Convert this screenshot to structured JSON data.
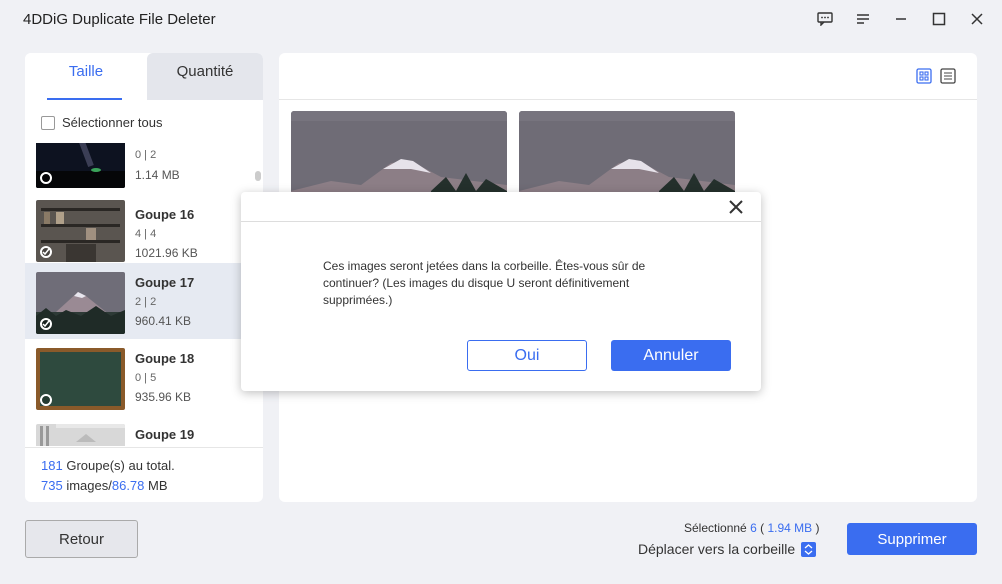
{
  "app": {
    "title": "4DDiG Duplicate File Deleter"
  },
  "tabs": [
    {
      "label": "Taille",
      "active": true
    },
    {
      "label": "Quantité",
      "active": false
    }
  ],
  "select_all_label": "Sélectionner tous",
  "groups": [
    {
      "name": "",
      "count": "0 | 2",
      "size": "1.14 MB",
      "checked": false,
      "thumb": "night-sky-icon"
    },
    {
      "name": "Goupe 16",
      "count": "4 | 4",
      "size": "1021.96 KB",
      "checked": true,
      "thumb": "bookshelf-icon"
    },
    {
      "name": "Goupe 17",
      "count": "2 | 2",
      "size": "960.41 KB",
      "checked": true,
      "thumb": "mountain-icon",
      "selected": true
    },
    {
      "name": "Goupe 18",
      "count": "0 | 5",
      "size": "935.96 KB",
      "checked": false,
      "thumb": "chalkboard-icon"
    },
    {
      "name": "Goupe 19",
      "count": "",
      "size": "",
      "checked": false,
      "thumb": "kitchen-icon"
    }
  ],
  "footer": {
    "groups_total": "181",
    "groups_total_text": "Groupe(s) au total.",
    "images_count": "735",
    "images_text": "images/",
    "images_size": "86.78",
    "images_unit": "MB"
  },
  "bottom": {
    "back_label": "Retour",
    "selected_prefix": "Sélectionné",
    "selected_count": "6",
    "selected_open": "(",
    "selected_size": "1.94 MB",
    "selected_close": ")",
    "move_label": "Déplacer vers la corbeille",
    "delete_label": "Supprimer"
  },
  "dialog": {
    "message": "Ces images seront jetées dans la corbeille. Êtes-vous sûr de continuer? (Les images du disque U seront définitivement supprimées.)",
    "yes_label": "Oui",
    "cancel_label": "Annuler"
  },
  "colors": {
    "accent": "#3a6df0",
    "background": "#f0f1f5"
  }
}
